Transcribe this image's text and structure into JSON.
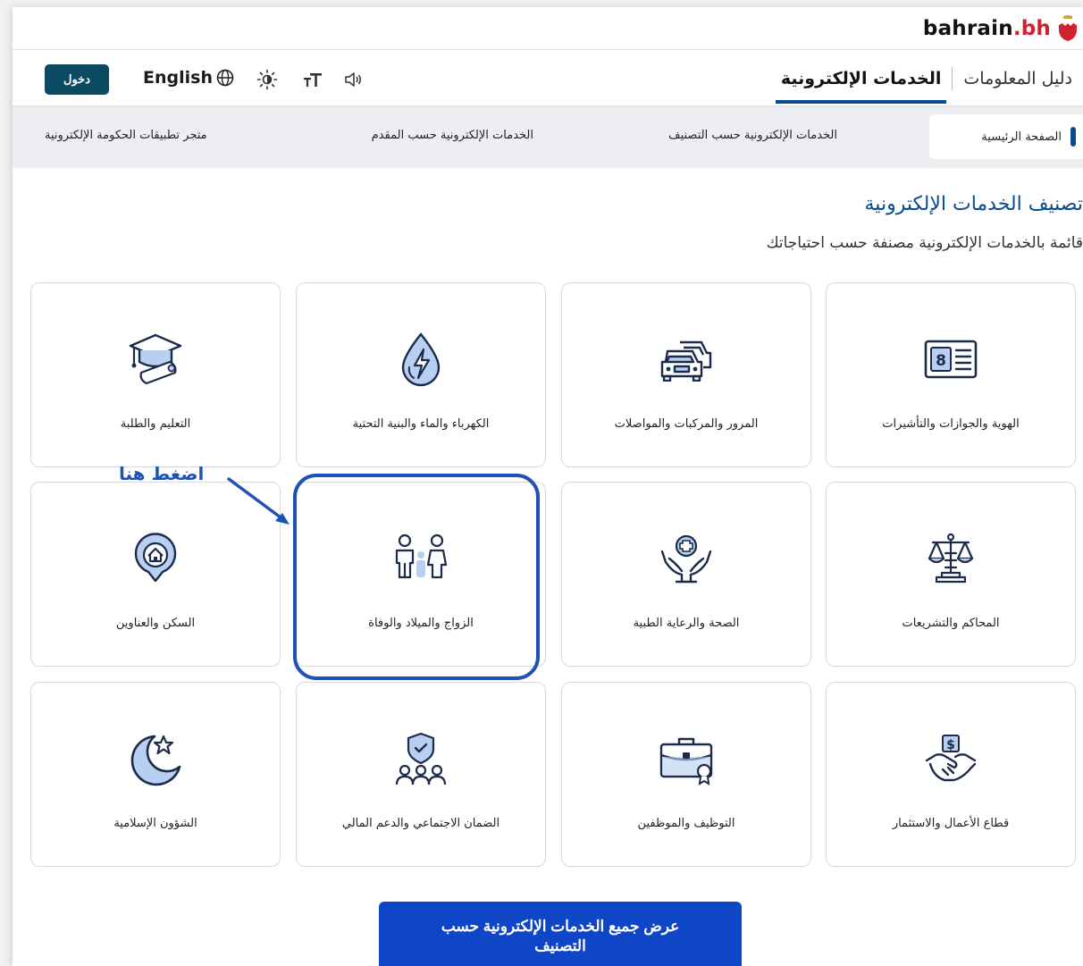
{
  "brand": {
    "name_main": "bahrain",
    "name_dot": ".bh"
  },
  "nav": {
    "login_label": "دخول",
    "language_label": "English",
    "tabs": [
      {
        "label": "الخدمات الإلكترونية",
        "active": true
      },
      {
        "label": "دليل المعلومات",
        "active": false
      }
    ]
  },
  "subnav": {
    "home": "الصفحة الرئيسية",
    "by_category": "الخدمات الإلكترونية حسب التصنيف",
    "by_provider": "الخدمات الإلكترونية حسب المقدم",
    "app_store": "متجر تطبيقات الحكومة الإلكترونية"
  },
  "section": {
    "title": "تصنيف الخدمات الإلكترونية",
    "subtitle": "قائمة بالخدمات الإلكترونية مصنفة حسب احتياجاتك"
  },
  "categories": [
    {
      "label": "الهوية والجوازات والتأشيرات",
      "icon": "id-card-icon"
    },
    {
      "label": "المرور والمركبات والمواصلات",
      "icon": "cars-icon"
    },
    {
      "label": "الكهرباء والماء والبنية التحتية",
      "icon": "water-electricity-icon"
    },
    {
      "label": "التعليم والطلبة",
      "icon": "graduation-cap-icon"
    },
    {
      "label": "المحاكم والتشريعات",
      "icon": "scales-icon"
    },
    {
      "label": "الصحة والرعاية الطبية",
      "icon": "health-care-icon"
    },
    {
      "label": "الزواج والميلاد والوفاة",
      "icon": "family-icon"
    },
    {
      "label": "السكن والعناوين",
      "icon": "housing-pin-icon"
    },
    {
      "label": "قطاع الأعمال والاستثمار",
      "icon": "business-handshake-icon"
    },
    {
      "label": "التوظيف والموظفين",
      "icon": "briefcase-icon"
    },
    {
      "label": "الضمان الاجتماعي والدعم المالي",
      "icon": "social-security-icon"
    },
    {
      "label": "الشؤون الإسلامية",
      "icon": "crescent-star-icon"
    }
  ],
  "annotation": {
    "label": "اضغط هنا"
  },
  "show_all_button": "عرض جميع الخدمات الإلكترونية حسب التصنيف",
  "colors": {
    "primary": "#0b4a8f",
    "accent_red": "#d3202f",
    "login_bg": "#0b4a62",
    "button_blue": "#0e46c7",
    "highlight": "#1f52b5",
    "icon_light": "#b8cff2"
  }
}
